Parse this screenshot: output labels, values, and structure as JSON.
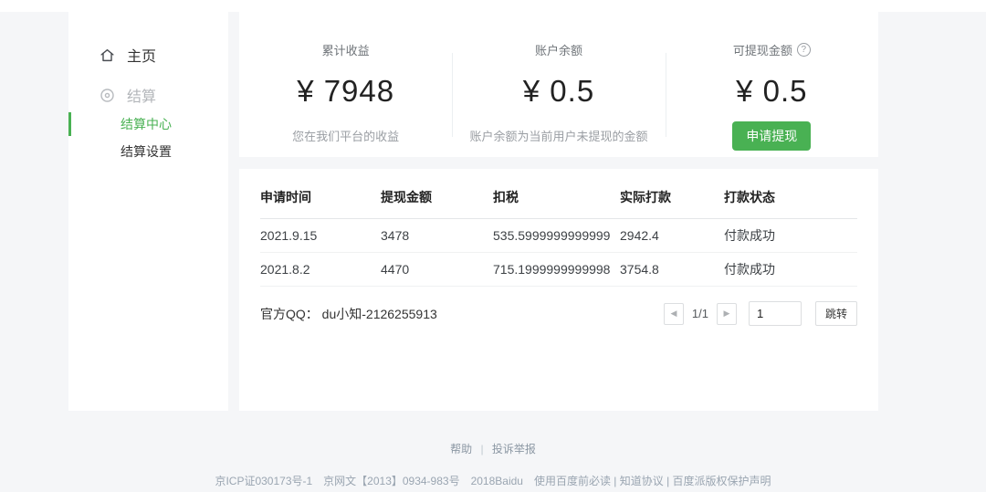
{
  "accent_color": "#49b153",
  "sidebar": {
    "home": {
      "label": "主页"
    },
    "settlement": {
      "label": "结算"
    },
    "settlement_center": {
      "label": "结算中心",
      "active": true
    },
    "settlement_settings": {
      "label": "结算设置"
    }
  },
  "stats": {
    "cards": [
      {
        "label": "累计收益",
        "value": "¥ 7948",
        "subtitle": "您在我们平台的收益"
      },
      {
        "label": "账户余额",
        "value": "¥ 0.5",
        "subtitle": "账户余额为当前用户未提现的金额"
      },
      {
        "label": "可提现金额",
        "value": "¥ 0.5",
        "help_icon": "?",
        "button_label": "申请提现"
      }
    ]
  },
  "table": {
    "headers": [
      "申请时间",
      "提现金额",
      "扣税",
      "实际打款",
      "打款状态"
    ],
    "rows": [
      [
        "2021.9.15",
        "3478",
        "535.5999999999999",
        "2942.4",
        "付款成功"
      ],
      [
        "2021.8.2",
        "4470",
        "715.1999999999998",
        "3754.8",
        "付款成功"
      ]
    ]
  },
  "table_footer": {
    "qq_text": "官方QQ： du小知-2126255913",
    "pagination": {
      "prev_icon": "◀",
      "indicator": "1/1",
      "next_icon": "▶",
      "input_value": "1",
      "jump_label": "跳转"
    }
  },
  "footer": {
    "help": "帮助",
    "separator": "|",
    "complaint": "投诉举报",
    "legal": "京ICP证030173号-1　京网文【2013】0934-983号　2018Baidu　使用百度前必读 | 知道协议 | 百度派版权保护声明"
  }
}
